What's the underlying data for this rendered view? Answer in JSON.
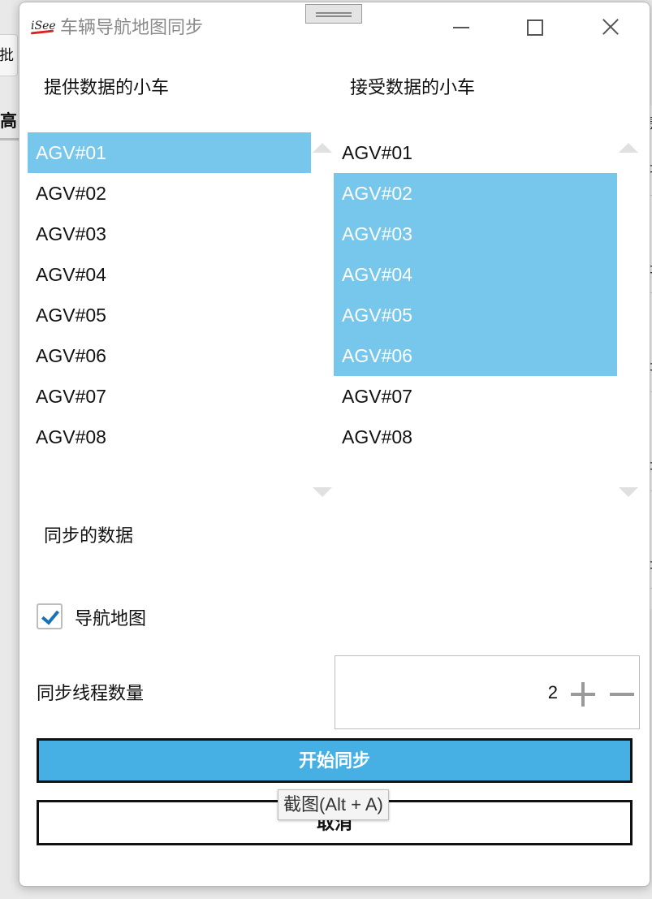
{
  "window": {
    "title": "车辆导航地图同步",
    "logo_text": "iSee"
  },
  "background": {
    "button_fragment": "批",
    "header_fragment": "高电",
    "right_column_fragments": [
      "患",
      "出",
      "出",
      "出",
      "出",
      "出",
      "出"
    ]
  },
  "source": {
    "label": "提供数据的小车",
    "items": [
      "AGV#01",
      "AGV#02",
      "AGV#03",
      "AGV#04",
      "AGV#05",
      "AGV#06",
      "AGV#07",
      "AGV#08"
    ],
    "selected": [
      "AGV#01"
    ]
  },
  "target": {
    "label": "接受数据的小车",
    "items": [
      "AGV#01",
      "AGV#02",
      "AGV#03",
      "AGV#04",
      "AGV#05",
      "AGV#06",
      "AGV#07",
      "AGV#08"
    ],
    "selected": [
      "AGV#02",
      "AGV#03",
      "AGV#04",
      "AGV#05",
      "AGV#06"
    ]
  },
  "sync_data": {
    "label": "同步的数据",
    "nav_map_label": "导航地图",
    "nav_map_checked": true
  },
  "threads": {
    "label": "同步线程数量",
    "value": "2"
  },
  "actions": {
    "start_label": "开始同步",
    "cancel_label": "取消"
  },
  "tooltip": {
    "text": "截图(Alt + A)"
  },
  "colors": {
    "selection": "#77c6ec",
    "primary_button": "#46b0e4",
    "checkbox_check": "#1773b6"
  }
}
